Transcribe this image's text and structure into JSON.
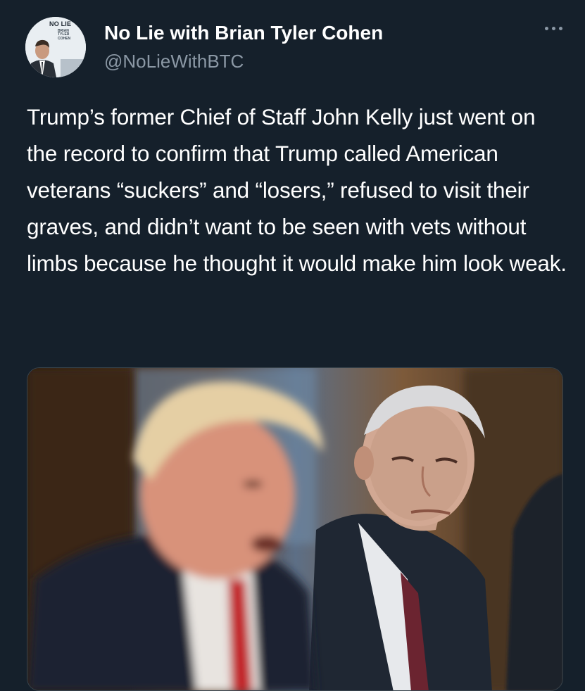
{
  "author": {
    "display_name": "No Lie with Brian Tyler Cohen",
    "handle": "@NoLieWithBTC",
    "avatar_logo_text": "NO LIE",
    "avatar_logo_sub": [
      "BRIAN",
      "TYLER",
      "COHEN"
    ]
  },
  "tweet": {
    "text": "Trump’s former Chief of Staff John Kelly just went on the record to confirm that Trump called American veterans “suckers” and “losers,” refused to visit their graves, and didn’t want to be seen with vets without limbs because he thought it would make him look weak."
  },
  "icons": {
    "more": "more-horizontal-icon"
  },
  "colors": {
    "background": "#15202b",
    "primary_text": "#ffffff",
    "secondary_text": "#8b98a5",
    "border": "#38444d"
  }
}
